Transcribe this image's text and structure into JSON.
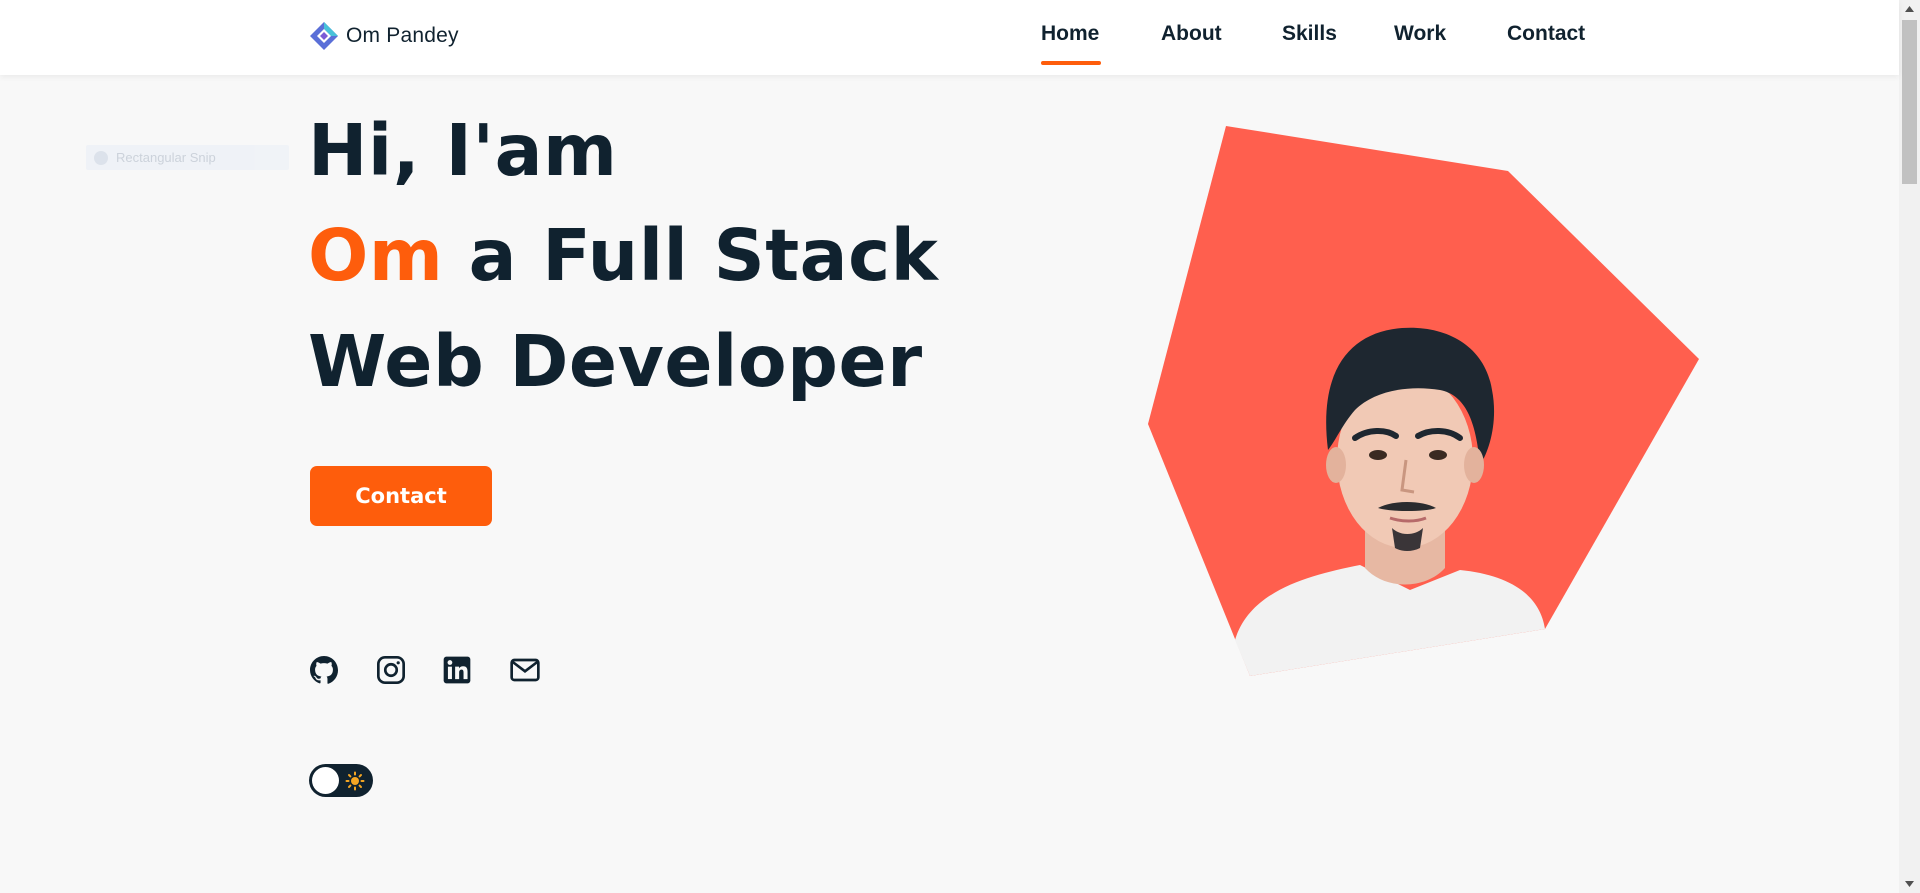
{
  "header": {
    "brand_name": "Om Pandey",
    "nav": [
      {
        "label": "Home",
        "active": true
      },
      {
        "label": "About",
        "active": false
      },
      {
        "label": "Skills",
        "active": false
      },
      {
        "label": "Work",
        "active": false
      },
      {
        "label": "Contact",
        "active": false
      }
    ]
  },
  "overlay": {
    "snip_label": "Rectangular Snip"
  },
  "hero": {
    "line1": "Hi, I'am",
    "name": "Om",
    "line2_rest": "a Full Stack",
    "line3": "Web Developer",
    "contact_button": "Contact"
  },
  "social": [
    {
      "icon": "github-icon"
    },
    {
      "icon": "instagram-icon"
    },
    {
      "icon": "linkedin-icon"
    },
    {
      "icon": "mail-icon"
    }
  ],
  "theme_toggle": {
    "icon": "sun-icon",
    "state": "light"
  },
  "colors": {
    "accent": "#fe5d0c",
    "text": "#10222f",
    "background": "#f8f8f8",
    "blob": "#ff5f4e"
  }
}
